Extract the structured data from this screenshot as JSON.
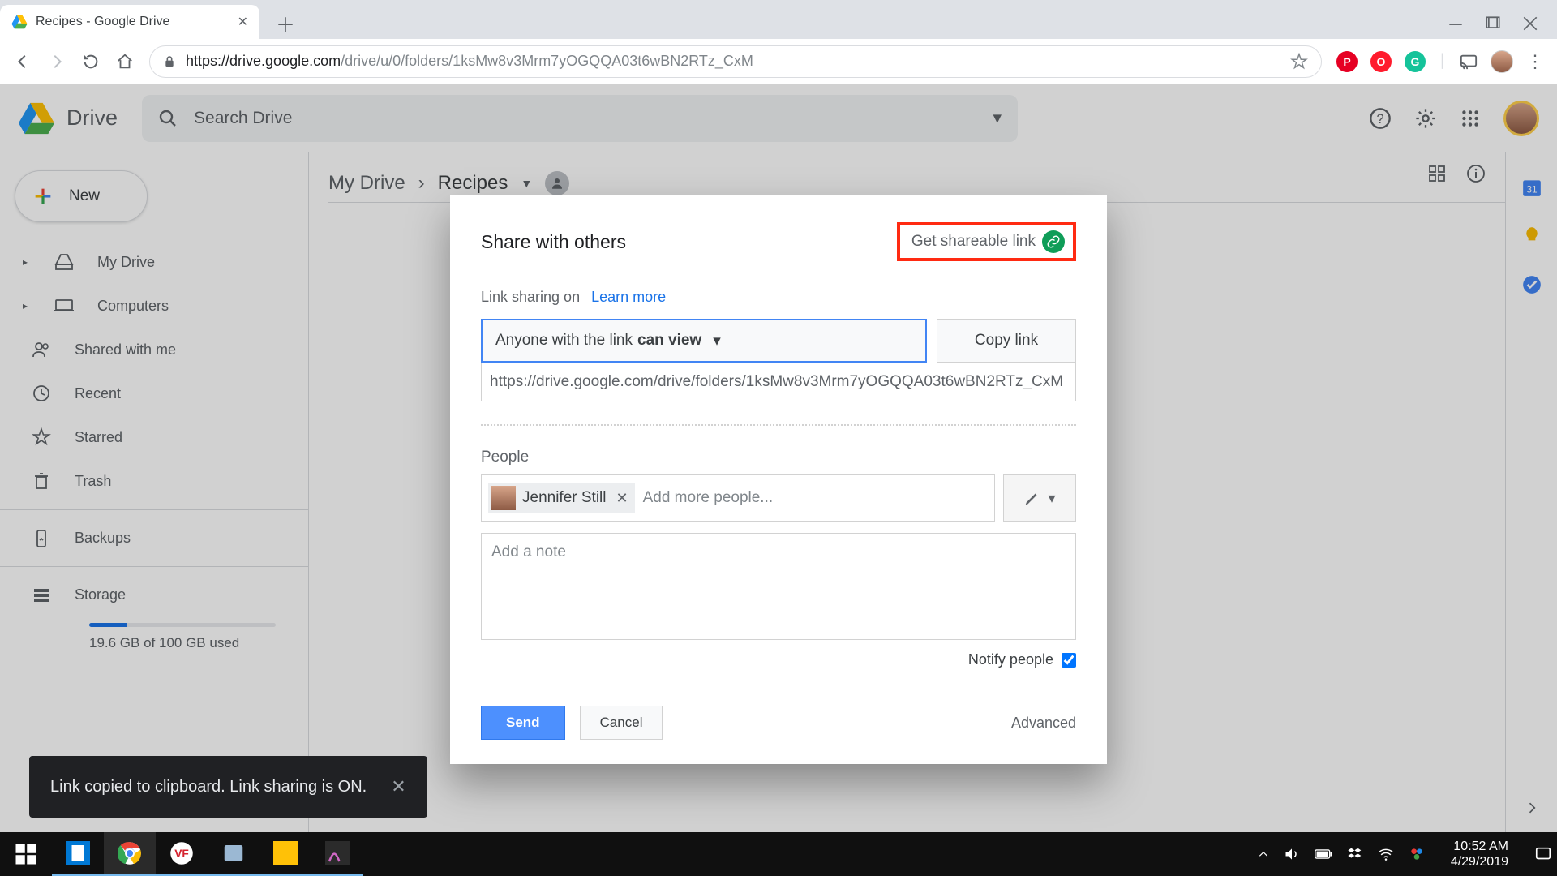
{
  "browser": {
    "tab_title": "Recipes - Google Drive",
    "url_host": "https://drive.google.com",
    "url_path": "/drive/u/0/folders/1ksMw8v3Mrm7yOGQQA03t6wBN2RTz_CxM"
  },
  "drive": {
    "app_name": "Drive",
    "search_placeholder": "Search Drive",
    "new_button": "New",
    "sidebar": {
      "my_drive": "My Drive",
      "computers": "Computers",
      "shared": "Shared with me",
      "recent": "Recent",
      "starred": "Starred",
      "trash": "Trash",
      "backups": "Backups",
      "storage": "Storage",
      "storage_used": "19.6 GB of 100 GB used"
    },
    "breadcrumb": {
      "root": "My Drive",
      "current": "Recipes"
    }
  },
  "dialog": {
    "title": "Share with others",
    "get_link": "Get shareable link",
    "link_status": "Link sharing on",
    "learn_more": "Learn more",
    "perm_prefix": "Anyone with the link ",
    "perm_mode": "can view",
    "copy_link": "Copy link",
    "share_url": "https://drive.google.com/drive/folders/1ksMw8v3Mrm7yOGQQA03t6wBN2RTz_CxM",
    "people_label": "People",
    "chip_name": "Jennifer Still",
    "add_more_placeholder": "Add more people...",
    "note_placeholder": "Add a note",
    "notify_label": "Notify people",
    "send": "Send",
    "cancel": "Cancel",
    "advanced": "Advanced"
  },
  "snackbar": {
    "text": "Link copied to clipboard. Link sharing is ON."
  },
  "taskbar": {
    "time": "10:52 AM",
    "date": "4/29/2019"
  }
}
